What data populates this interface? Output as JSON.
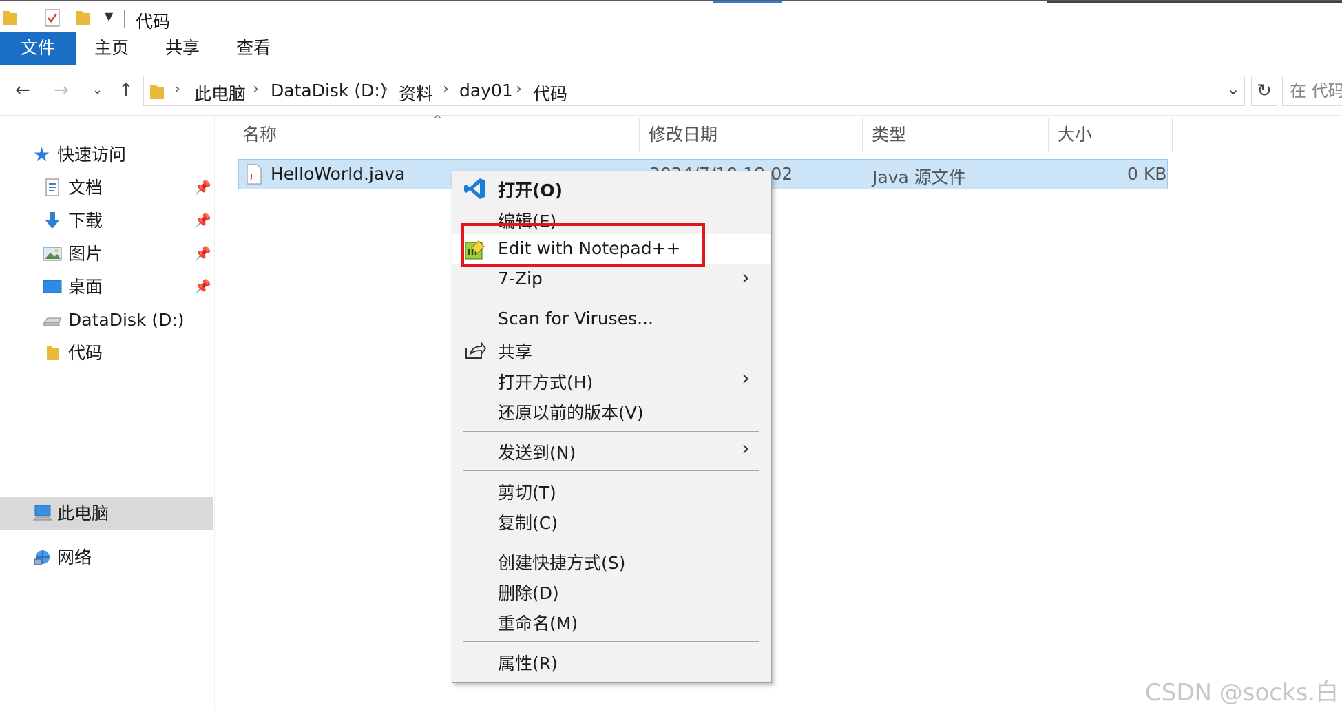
{
  "window": {
    "title": "代码"
  },
  "ribbon": {
    "tabs": [
      "文件",
      "主页",
      "共享",
      "查看"
    ]
  },
  "address": {
    "crumbs": [
      "此电脑",
      "DataDisk (D:)",
      "资料",
      "day01",
      "代码"
    ],
    "search_placeholder": "在 代码"
  },
  "nav": {
    "quick_access": "快速访问",
    "items": [
      {
        "label": "文档",
        "pinned": true
      },
      {
        "label": "下载",
        "pinned": true
      },
      {
        "label": "图片",
        "pinned": true
      },
      {
        "label": "桌面",
        "pinned": true
      },
      {
        "label": "DataDisk (D:)",
        "pinned": false
      },
      {
        "label": "代码",
        "pinned": false
      }
    ],
    "this_pc": "此电脑",
    "network": "网络"
  },
  "columns": {
    "name": "名称",
    "modified": "修改日期",
    "type": "类型",
    "size": "大小"
  },
  "file": {
    "name": "HelloWorld.java",
    "modified": "2024/7/10 18:02",
    "type": "Java 源文件",
    "size": "0 KB"
  },
  "context_menu": {
    "open": "打开(O)",
    "edit": "编辑(E)",
    "notepad": "Edit with Notepad++",
    "zip": "7-Zip",
    "scan": "Scan for Viruses...",
    "share": "共享",
    "open_with": "打开方式(H)",
    "restore": "还原以前的版本(V)",
    "send_to": "发送到(N)",
    "cut": "剪切(T)",
    "copy": "复制(C)",
    "shortcut": "创建快捷方式(S)",
    "delete": "删除(D)",
    "rename": "重命名(M)",
    "properties": "属性(R)"
  },
  "watermark": "CSDN @socks.白",
  "colors": {
    "accent": "#1a6fc5",
    "selection": "#cce4f7",
    "highlight": "#e5141d"
  }
}
